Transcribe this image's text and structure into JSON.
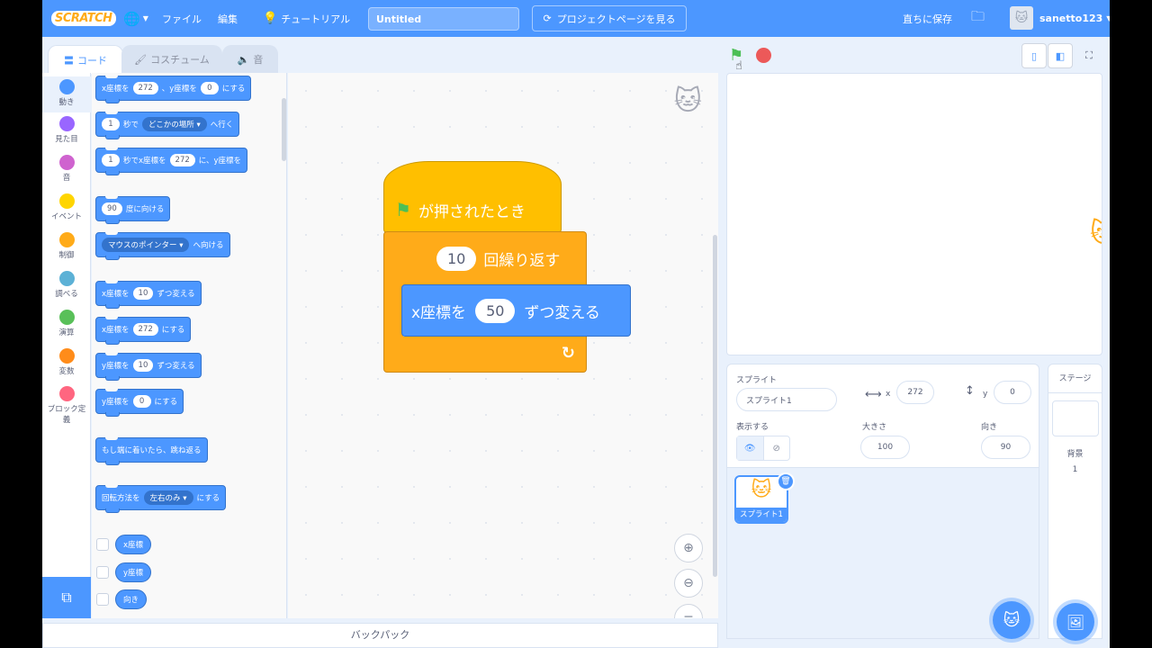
{
  "menubar": {
    "logo": "SCRATCH",
    "file": "ファイル",
    "edit": "編集",
    "tutorials": "チュートリアル",
    "project_title": "Untitled",
    "see_project_page": "プロジェクトページを見る",
    "save_now": "直ちに保存",
    "username": "sanetto123"
  },
  "tabs": {
    "code": "コード",
    "costumes": "コスチューム",
    "sounds": "音"
  },
  "categories": [
    {
      "label": "動き",
      "color": "#4c97ff"
    },
    {
      "label": "見た目",
      "color": "#9966ff"
    },
    {
      "label": "音",
      "color": "#cf63cf"
    },
    {
      "label": "イベント",
      "color": "#ffd500"
    },
    {
      "label": "制御",
      "color": "#ffab19"
    },
    {
      "label": "調べる",
      "color": "#5cb1d6"
    },
    {
      "label": "演算",
      "color": "#59c059"
    },
    {
      "label": "変数",
      "color": "#ff8c1a"
    },
    {
      "label": "ブロック定義",
      "color": "#ff6680"
    }
  ],
  "palette": {
    "goto_xy": {
      "a": "x座標を",
      "x": "272",
      "b": "、y座標を",
      "y": "0",
      "c": "にする"
    },
    "glide_to": {
      "secs": "1",
      "a": "秒で",
      "target": "どこかの場所",
      "b": "へ行く"
    },
    "glide_xy": {
      "secs": "1",
      "a": "秒でx座標を",
      "x": "272",
      "b": "に、y座標を"
    },
    "point_dir": {
      "deg": "90",
      "a": "度に向ける"
    },
    "point_toward": {
      "target": "マウスのポインター",
      "a": "へ向ける"
    },
    "change_x": {
      "a": "x座標を",
      "v": "10",
      "b": "ずつ変える"
    },
    "set_x": {
      "a": "x座標を",
      "v": "272",
      "b": "にする"
    },
    "change_y": {
      "a": "y座標を",
      "v": "10",
      "b": "ずつ変える"
    },
    "set_y": {
      "a": "y座標を",
      "v": "0",
      "b": "にする"
    },
    "bounce": "もし端に着いたら、跳ね返る",
    "rotation": {
      "a": "回転方法を",
      "mode": "左右のみ",
      "b": "にする"
    },
    "reporters": [
      "x座標",
      "y座標",
      "向き"
    ]
  },
  "script": {
    "hat": "が押されたとき",
    "repeat_count": "10",
    "repeat_label": "回繰り返す",
    "change_x_a": "x座標を",
    "change_x_value": "50",
    "change_x_b": "ずつ変える"
  },
  "sprite_info": {
    "sprite_label": "スプライト",
    "sprite_name": "スプライト1",
    "x_label": "x",
    "x": "272",
    "y_label": "y",
    "y": "0",
    "show_label": "表示する",
    "size_label": "大きさ",
    "size": "100",
    "direction_label": "向き",
    "direction": "90"
  },
  "sprite_tile": {
    "name": "スプライト1"
  },
  "stage_panel": {
    "title": "ステージ",
    "backdrops_label": "背景",
    "backdrops_count": "1"
  },
  "backpack": "バックパック"
}
